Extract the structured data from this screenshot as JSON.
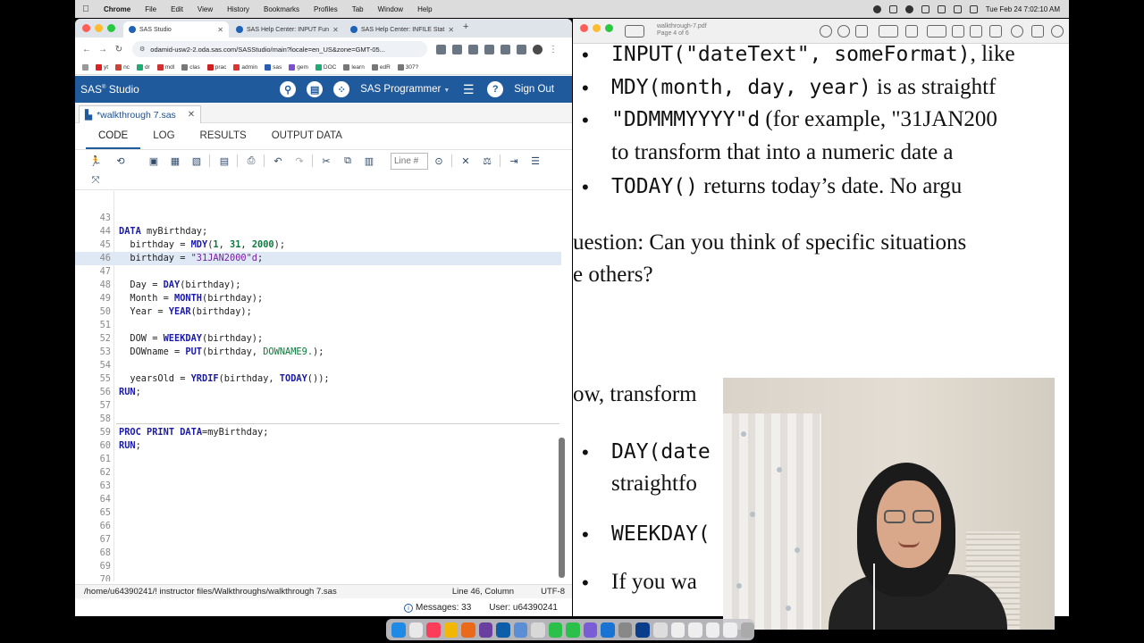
{
  "menubar": {
    "app": "Chrome",
    "items": [
      "File",
      "Edit",
      "View",
      "History",
      "Bookmarks",
      "Profiles",
      "Tab",
      "Window",
      "Help"
    ],
    "clock": "Tue Feb 24  7:02:10 AM"
  },
  "browser": {
    "tabs": [
      {
        "title": "SAS Studio",
        "active": true
      },
      {
        "title": "SAS Help Center: INPUT Fun",
        "active": false
      },
      {
        "title": "SAS Help Center: INFILE Stat",
        "active": false
      }
    ],
    "url": "odamid-usw2-2.oda.sas.com/SASStudio/main?locale=en_US&zone=GMT-05...",
    "bookmarks": [
      "yt",
      "nc",
      "dr",
      "mdl",
      "clas",
      "prac",
      "admin",
      "sas",
      "gem",
      "DOC",
      "learn",
      "edR",
      "307?"
    ]
  },
  "sas": {
    "title": "SAS",
    "title_sup": "®",
    "title_rest": " Studio",
    "mode": "SAS Programmer",
    "signout": "Sign Out",
    "file_tab": "*walkthrough 7.sas",
    "view_tabs": [
      "CODE",
      "LOG",
      "RESULTS",
      "OUTPUT DATA"
    ],
    "line_placeholder": "Line #",
    "status_path": "/home/u64390241/! instructor files/Walkthroughs/walkthrough 7.sas",
    "status_pos": "Line 46, Column",
    "status_enc": "UTF-8",
    "messages": "Messages: 33",
    "user": "User: u64390241"
  },
  "code": {
    "first_line": 43,
    "current_line": 46,
    "lines": [
      "",
      "DATA myBirthday;",
      "  birthday = MDY(1, 31, 2000);",
      "  birthday = \"31JAN2000\"d;",
      "",
      "  Day = DAY(birthday);",
      "  Month = MONTH(birthday);",
      "  Year = YEAR(birthday);",
      "",
      "  DOW = WEEKDAY(birthday);",
      "  DOWname = PUT(birthday, DOWNAME9.);",
      "",
      "  yearsOld = YRDIF(birthday, TODAY());",
      "RUN;",
      "",
      "",
      "PROC PRINT DATA=myBirthday;",
      "RUN;",
      "",
      "",
      "",
      "",
      "",
      "",
      "",
      "",
      "",
      "",
      "",
      "",
      ""
    ]
  },
  "pdf": {
    "title": "walkthrough-7.pdf",
    "subtitle": "Page 4 of 6",
    "lines": [
      {
        "type": "bullet",
        "code": "INPUT(\"dateText\", someFormat)",
        "text": ", like"
      },
      {
        "type": "bullet",
        "code": "MDY(month, day, year)",
        "text": " is as straightf"
      },
      {
        "type": "bullet",
        "code": "\"DDMMMYYYY\"d",
        "text": " (for example, \"31JAN200"
      },
      {
        "type": "cont",
        "code": "",
        "text": "to transform that into a numeric date a"
      },
      {
        "type": "bullet",
        "code": "TODAY()",
        "text": " returns today’s date. No argu"
      },
      {
        "type": "plain",
        "code": "",
        "text": "uestion: Can you think of specific situations"
      },
      {
        "type": "plain",
        "code": "",
        "text": "e others?"
      },
      {
        "type": "plain",
        "code": "",
        "text": "ow, transform"
      },
      {
        "type": "bullet",
        "code": "DAY(date",
        "text": ""
      },
      {
        "type": "cont",
        "code": "",
        "text": "straightfo"
      },
      {
        "type": "bullet",
        "code": "WEEKDAY(",
        "text": ""
      },
      {
        "type": "bullet",
        "code": "",
        "text": "If you wa"
      }
    ]
  },
  "colors": {
    "sas_header": "#1f5a9c",
    "keyword": "#1a1aa6",
    "number": "#0a7a3c",
    "string": "#7a1fa0"
  }
}
